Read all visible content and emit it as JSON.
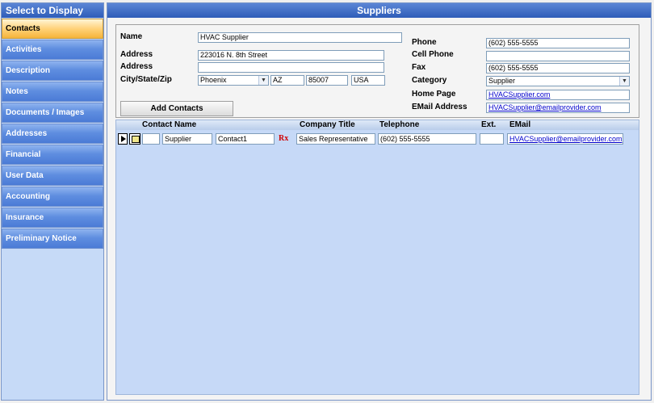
{
  "left_panel": {
    "title": "Select to Display",
    "items": [
      {
        "label": "Contacts",
        "active": true
      },
      {
        "label": "Activities"
      },
      {
        "label": "Description"
      },
      {
        "label": "Notes"
      },
      {
        "label": "Documents / Images"
      },
      {
        "label": "Addresses"
      },
      {
        "label": "Financial"
      },
      {
        "label": "User Data"
      },
      {
        "label": "Accounting"
      },
      {
        "label": "Insurance"
      },
      {
        "label": "Preliminary Notice"
      }
    ]
  },
  "main": {
    "title": "Suppliers",
    "labels": {
      "name": "Name",
      "address1": "Address",
      "address2": "Address",
      "city_state_zip": "City/State/Zip",
      "phone": "Phone",
      "cell_phone": "Cell Phone",
      "fax": "Fax",
      "category": "Category",
      "home_page": "Home Page",
      "email": "EMail Address"
    },
    "values": {
      "name": "HVAC Supplier",
      "address1": "223016 N. 8th Street",
      "address2": "",
      "city": "Phoenix",
      "state": "AZ",
      "zip": "85007",
      "country": "USA",
      "phone": "(602) 555-5555",
      "cell_phone": "",
      "fax": "(602) 555-5555",
      "category": "Supplier",
      "home_page": "HVACSupplier.com",
      "email": "HVACSupplier@emailprovider.com"
    },
    "add_contacts_label": "Add Contacts",
    "grid": {
      "columns": {
        "contact_name": "Contact Name",
        "company_title": "Company Title",
        "telephone": "Telephone",
        "ext": "Ext.",
        "email": "EMail"
      },
      "rows": [
        {
          "salutation": "",
          "first": "Supplier",
          "last": "Contact1",
          "company_title": "Sales Representative",
          "telephone": "(602) 555-5555",
          "ext": "",
          "email": "HVACSupplier@emailprovider.com"
        }
      ],
      "rx_icon": "Rx"
    }
  },
  "colors": {
    "title_bar": "#2e5cb8",
    "nav_active": "#f5b43a",
    "grid_bg": "#c6d9f7",
    "link": "#0000cc"
  }
}
